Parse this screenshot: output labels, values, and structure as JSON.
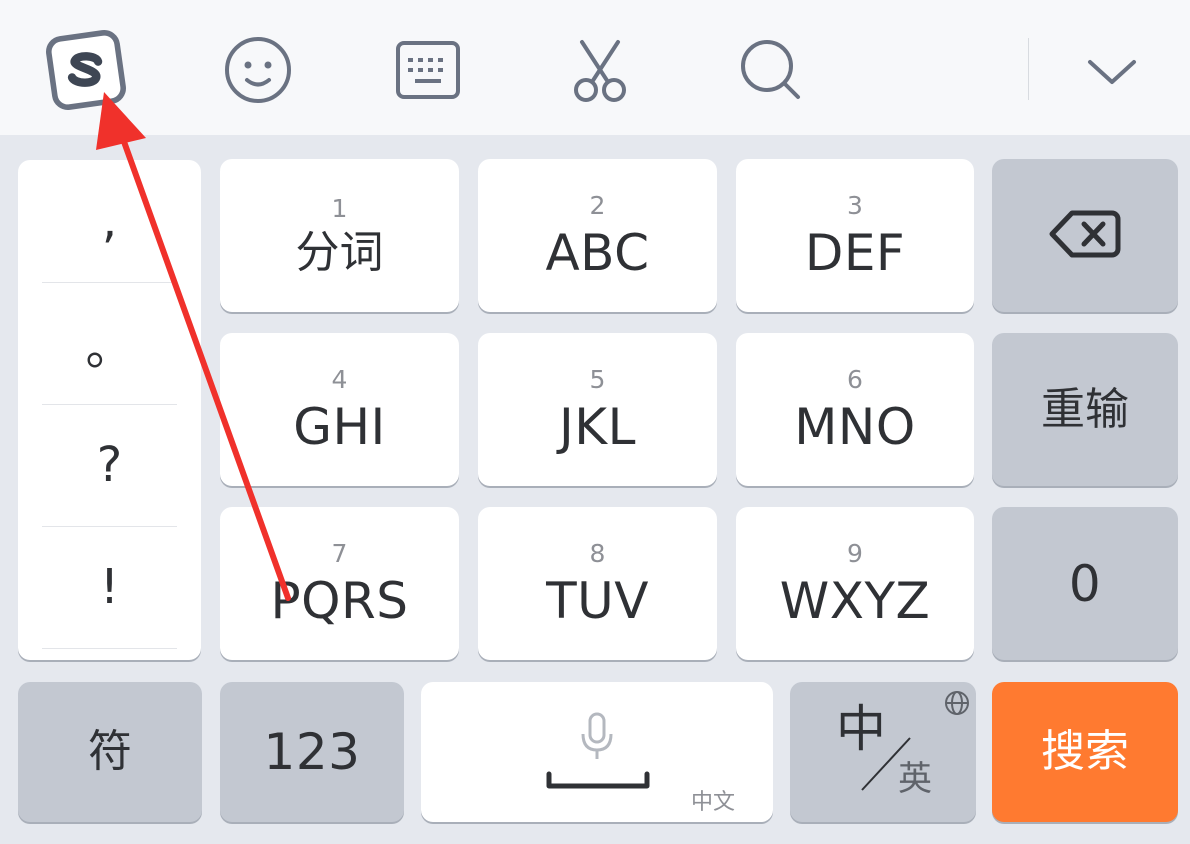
{
  "toolbar": {
    "icons": [
      "sogou-logo-icon",
      "emoji-icon",
      "keyboard-icon",
      "scissors-icon",
      "search-icon",
      "chevron-down-icon"
    ]
  },
  "punctuation": [
    ",",
    "。",
    "?",
    "!"
  ],
  "keys": {
    "k1": {
      "digit": "1",
      "label": "分词"
    },
    "k2": {
      "digit": "2",
      "label": "ABC"
    },
    "k3": {
      "digit": "3",
      "label": "DEF"
    },
    "k4": {
      "digit": "4",
      "label": "GHI"
    },
    "k5": {
      "digit": "5",
      "label": "JKL"
    },
    "k6": {
      "digit": "6",
      "label": "MNO"
    },
    "k7": {
      "digit": "7",
      "label": "PQRS"
    },
    "k8": {
      "digit": "8",
      "label": "TUV"
    },
    "k9": {
      "digit": "9",
      "label": "WXYZ"
    }
  },
  "side_keys": {
    "backspace_icon": "backspace-icon",
    "reenter": "重输",
    "zero": "0"
  },
  "bottom_row": {
    "symbols": "符",
    "numbers": "123",
    "space_sub": "中文",
    "lang_main": "中",
    "lang_sub": "英",
    "search": "搜索"
  },
  "colors": {
    "accent": "#ff7a30",
    "annotation_arrow": "#f0312b"
  }
}
